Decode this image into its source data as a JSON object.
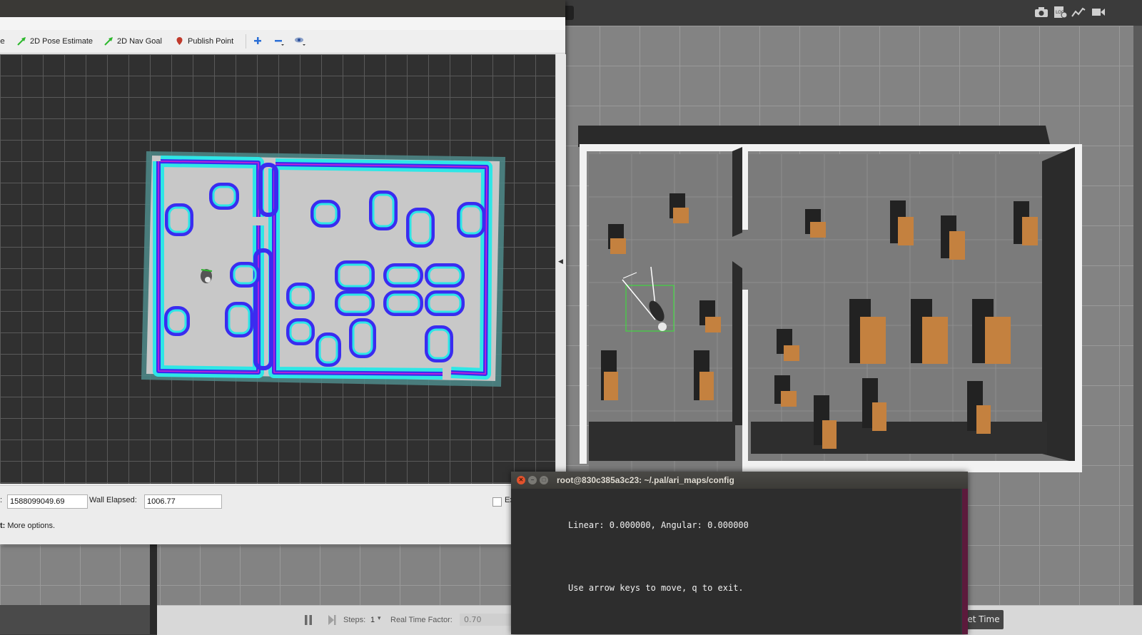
{
  "rviz": {
    "tools": [
      {
        "label": "2D Pose Estimate",
        "icon": "pose-arrow-icon"
      },
      {
        "label": "2D Nav Goal",
        "icon": "nav-arrow-icon"
      },
      {
        "label": "Publish Point",
        "icon": "map-pin-icon"
      }
    ],
    "view_icons": [
      "zoom-in-icon",
      "zoom-out-icon",
      "eye-icon"
    ],
    "time": {
      "ros_time_suffix": ":",
      "ros_time_value": "1588099049.69",
      "wall_elapsed_label": "Wall Elapsed:",
      "wall_elapsed_value": "1006.77",
      "experimental_label": "Ex"
    },
    "status": {
      "prefix": "t:",
      "text": " More options."
    }
  },
  "terminal": {
    "title": "root@830c385a3c23: ~/.pal/ari_maps/config",
    "lines": [
      "Linear: 0.000000, Angular: 0.000000",
      "Use arrow keys to move, q to exit."
    ]
  },
  "gazebo": {
    "toolbar_icons": [
      "camera-icon",
      "log-icon",
      "plot-icon",
      "video-icon"
    ],
    "bottom": {
      "steps_label": "Steps:",
      "steps_value": "1",
      "rtf_label": "Real Time Factor:",
      "rtf_value": "0.70",
      "reset_time_label": "et Time"
    }
  },
  "colors": {
    "costmap_cyan": "#2ee6e6",
    "costmap_blue": "#3a2cf0",
    "costmap_magenta": "#d21fd2",
    "box_wood": "#c4813f"
  }
}
